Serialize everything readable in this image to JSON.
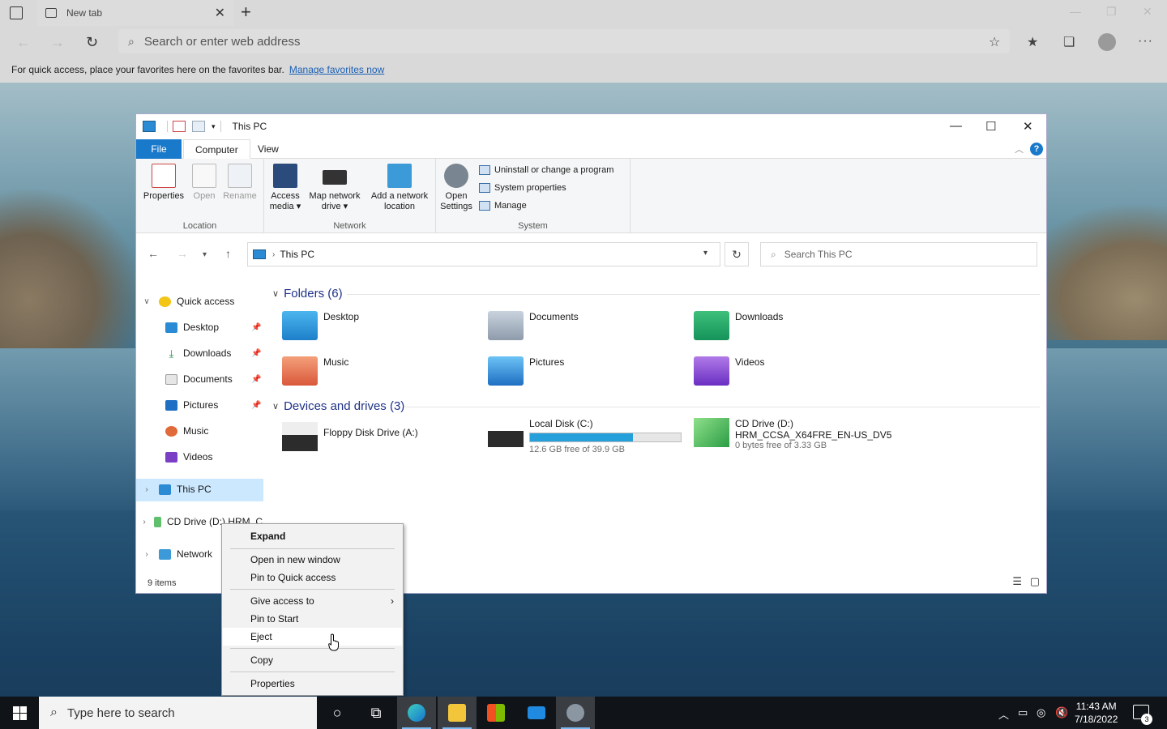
{
  "browser": {
    "tab_label": "New tab",
    "address_placeholder": "Search or enter web address",
    "favbar_text": "For quick access, place your favorites here on the favorites bar.",
    "favbar_link": "Manage favorites now"
  },
  "explorer": {
    "title": "This PC",
    "ribbon_tabs": [
      "File",
      "Computer",
      "View"
    ],
    "ribbon": {
      "location": {
        "label": "Location",
        "buttons": [
          "Properties",
          "Open",
          "Rename"
        ]
      },
      "network": {
        "label": "Network",
        "access_media": [
          "Access",
          "media"
        ],
        "map_drive": [
          "Map network",
          "drive"
        ],
        "add_location": [
          "Add a network",
          "location"
        ]
      },
      "system": {
        "label": "System",
        "open_settings": [
          "Open",
          "Settings"
        ],
        "uninstall": "Uninstall or change a program",
        "system_properties": "System properties",
        "manage": "Manage"
      }
    },
    "address": {
      "crumb": "This PC"
    },
    "search_placeholder": "Search This PC",
    "nav": {
      "quick_access": "Quick access",
      "desktop": "Desktop",
      "downloads": "Downloads",
      "documents": "Documents",
      "pictures": "Pictures",
      "music": "Music",
      "videos": "Videos",
      "this_pc": "This PC",
      "cd_drive": "CD Drive (D:) HRM_C",
      "network": "Network"
    },
    "status": "9 items",
    "folders_header": "Folders (6)",
    "folders": [
      "Desktop",
      "Documents",
      "Downloads",
      "Music",
      "Pictures",
      "Videos"
    ],
    "devices_header": "Devices and drives (3)",
    "drives": {
      "floppy": "Floppy Disk Drive (A:)",
      "local_c": "Local Disk (C:)",
      "local_c_free": "12.6 GB free of 39.9 GB",
      "local_c_used_fraction": 0.684,
      "cd_d": "CD Drive (D:)",
      "cd_d_label": "HRM_CCSA_X64FRE_EN-US_DV5",
      "cd_d_free": "0 bytes free of 3.33 GB"
    }
  },
  "context_menu": {
    "expand": "Expand",
    "open_new_window": "Open in new window",
    "pin_quick_access": "Pin to Quick access",
    "give_access": "Give access to",
    "pin_start": "Pin to Start",
    "eject": "Eject",
    "copy": "Copy",
    "properties": "Properties"
  },
  "taskbar": {
    "search_placeholder": "Type here to search",
    "time": "11:43 AM",
    "date": "7/18/2022",
    "notification_count": "3"
  },
  "colors": {
    "accent": "#1979ca",
    "selection": "#cce8ff",
    "capacity_fill": "#26a0da",
    "taskbar": "#101318"
  }
}
